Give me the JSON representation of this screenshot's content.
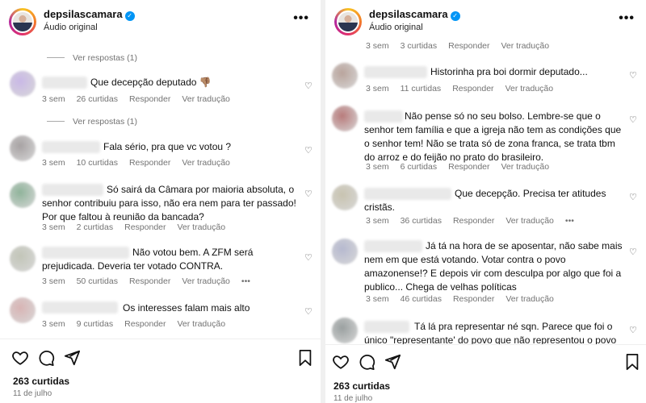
{
  "left": {
    "header": {
      "username": "depsilascamara",
      "subtitle": "Áudio original"
    },
    "replies_label": "Ver respostas (1)",
    "comments": [
      {
        "text": "Que decepção deputado 👎🏽",
        "time": "3 sem",
        "likes": "26 curtidas",
        "reply": "Responder",
        "translate": "Ver tradução",
        "avatar_color": "#c9b8e6"
      },
      {
        "text": "Fala sério, pra que vc votou ?",
        "time": "3 sem",
        "likes": "10 curtidas",
        "reply": "Responder",
        "translate": "Ver tradução",
        "avatar_color": "#a7a2a3"
      },
      {
        "text": "Só sairá da Câmara por maioria absoluta, o senhor contribuiu para isso, não era nem para ter passado! Por que faltou à reunião da bancada?",
        "time": "3 sem",
        "likes": "2 curtidas",
        "reply": "Responder",
        "translate": "Ver tradução",
        "avatar_color": "#8fb39a"
      },
      {
        "text": "Não votou bem. A ZFM será prejudicada. Deveria ter votado CONTRA.",
        "time": "3 sem",
        "likes": "50 curtidas",
        "reply": "Responder",
        "translate": "Ver tradução",
        "extra": "•••",
        "avatar_color": "#c2c5b8"
      },
      {
        "text": "Os interesses falam mais alto",
        "time": "3 sem",
        "likes": "9 curtidas",
        "reply": "Responder",
        "translate": "Ver tradução",
        "avatar_color": "#d8b4b4"
      }
    ],
    "footer": {
      "likes": "263 curtidas",
      "date": "11 de julho"
    }
  },
  "right": {
    "header": {
      "username": "depsilascamara",
      "subtitle": "Áudio original"
    },
    "top_meta": {
      "time": "3 sem",
      "likes": "3 curtidas",
      "reply": "Responder",
      "translate": "Ver tradução"
    },
    "comments": [
      {
        "text": "Historinha pra boi dormir deputado...",
        "time": "3 sem",
        "likes": "11 curtidas",
        "reply": "Responder",
        "translate": "Ver tradução",
        "avatar_color": "#b9a49c"
      },
      {
        "text": "Não pense só no seu bolso. Lembre-se que o senhor tem família e que a igreja não tem as condições que o senhor tem! Não se trata só de zona franca, se trata tbm do arroz e do feijão no prato do brasileiro.",
        "time": "3 sem",
        "likes": "6 curtidas",
        "reply": "Responder",
        "translate": "Ver tradução",
        "avatar_color": "#b87b7b"
      },
      {
        "text": "Que decepção. Precisa ter atitudes cristãs.",
        "time": "3 sem",
        "likes": "36 curtidas",
        "reply": "Responder",
        "translate": "Ver tradução",
        "extra": "•••",
        "avatar_color": "#c8c3b0"
      },
      {
        "text": "Já tá na hora de se aposentar, não sabe mais nem em que está votando. Votar contra o povo amazonense!? E depois vir com desculpa por algo que foi a publico... Chega de velhas políticas",
        "time": "3 sem",
        "likes": "46 curtidas",
        "reply": "Responder",
        "translate": "Ver tradução",
        "avatar_color": "#b6b9cf"
      },
      {
        "text": "Tá lá pra representar né sqn. Parece que foi o único \"representante' do povo que não representou o povo",
        "avatar_color": "#9aa0a0"
      }
    ],
    "footer": {
      "likes": "263 curtidas",
      "date": "11 de julho"
    }
  }
}
